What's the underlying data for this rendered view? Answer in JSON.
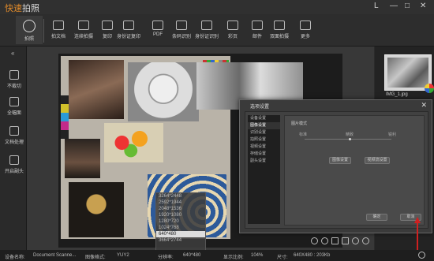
{
  "app": {
    "name_part1": "快速",
    "name_part2": "拍照"
  },
  "window_controls": {
    "skin": "L",
    "minimize": "—",
    "maximize": "□",
    "close": "✕"
  },
  "toolbar": {
    "items": [
      {
        "label": "拍照"
      },
      {
        "label": "拍文档"
      },
      {
        "label": "连续拍摄"
      },
      {
        "label": "复印"
      },
      {
        "label": "身份证复印"
      },
      {
        "label": "PDF"
      },
      {
        "label": "条码识别"
      },
      {
        "label": "身份证识别"
      },
      {
        "label": "彩页"
      },
      {
        "label": "邮件"
      },
      {
        "label": "双面拍摄"
      },
      {
        "label": "更多"
      }
    ]
  },
  "sidebar": {
    "collapse_icon": "«",
    "items": [
      {
        "label": "不裁切"
      },
      {
        "label": "全幅面"
      },
      {
        "label": "文档处理"
      },
      {
        "label": "开启副头"
      }
    ]
  },
  "thumbnails": [
    {
      "filename": "IMG_1.jpg"
    }
  ],
  "resolution_list": {
    "options": [
      "3264*2448",
      "2592*1944",
      "2048*1536",
      "1920*1080",
      "1280*720",
      "1024*768",
      "640*480",
      "3664*2744"
    ],
    "selected_index": 6
  },
  "status": {
    "device_label": "设备名称:",
    "device_value": "Document Scanne...",
    "format_label": "图像格式:",
    "format_value": "YUY2",
    "resolution_label": "分辨率:",
    "resolution_value": "640*480",
    "zoom_label": "显示比例:",
    "zoom_value": "104%",
    "size_label": "尺寸:",
    "size_value": "640X480 : 203Kb"
  },
  "dialog": {
    "title": "选项设置",
    "close": "✕",
    "tabs": [
      "设备设置",
      "图像设置",
      "识别设置",
      "拍照设置",
      "视频设置",
      "存储设置",
      "副头设置"
    ],
    "selected_tab": 1,
    "mode_label": "图片模式",
    "slider_labels": [
      "标准",
      "精致",
      "锐利"
    ],
    "btn_image_settings": "图像设置",
    "btn_video_settings": "视频流设置",
    "btn_ok": "确定",
    "btn_cancel": "取消"
  },
  "colors": {
    "accent": "#e08a2a",
    "background": "#2b2b2b",
    "arrow": "#d02020"
  }
}
